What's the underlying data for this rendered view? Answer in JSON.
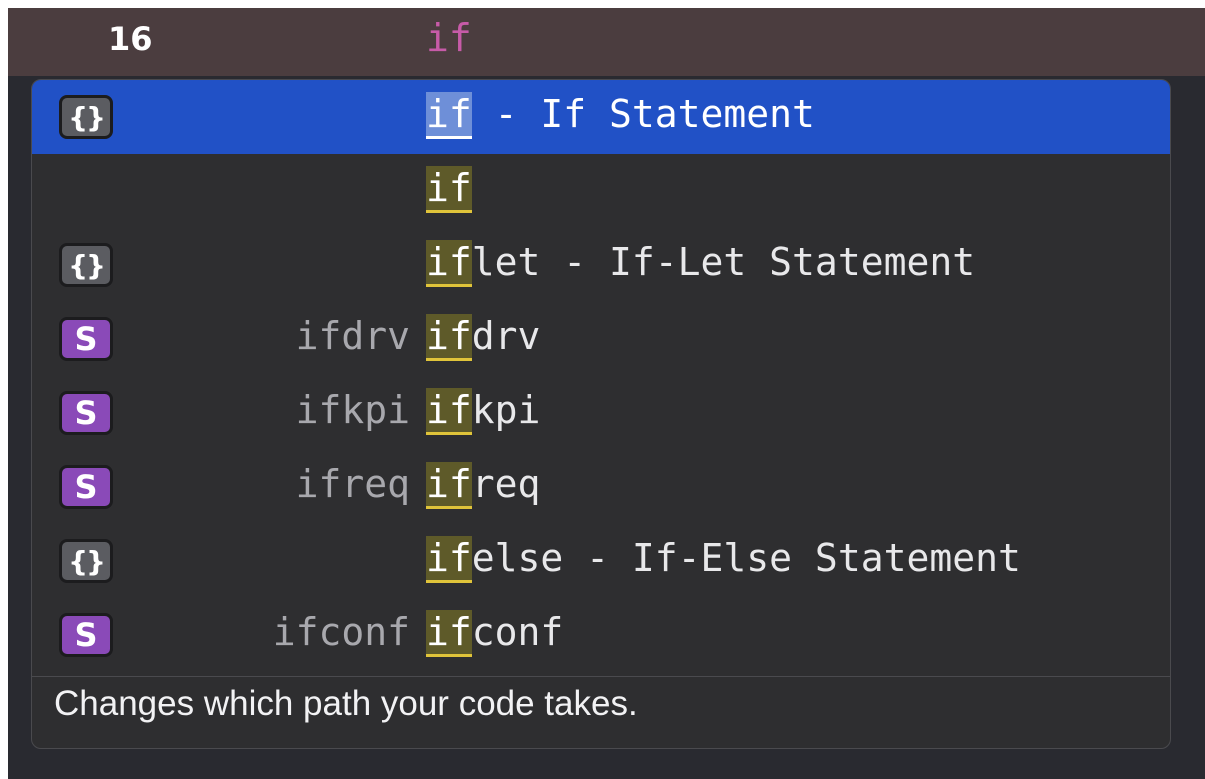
{
  "editor": {
    "line_number": "16",
    "line_code": "if",
    "colors": {
      "background": "#292a30",
      "current_line": "#4b3d3f",
      "keyword": "#c75ba8"
    }
  },
  "completion_popup": {
    "items": [
      {
        "icon": "snippet-braces-icon",
        "badge": "{}",
        "type_hint": "",
        "match": "if",
        "rest": " - If Statement",
        "selected": true
      },
      {
        "icon": "",
        "badge": "",
        "type_hint": "",
        "match": "if",
        "rest": "",
        "selected": false
      },
      {
        "icon": "snippet-braces-icon",
        "badge": "{}",
        "type_hint": "",
        "match": "if",
        "rest": "let - If-Let Statement",
        "selected": false
      },
      {
        "icon": "struct-s-icon",
        "badge": "S",
        "type_hint": "ifdrv",
        "match": "if",
        "rest": "drv",
        "selected": false
      },
      {
        "icon": "struct-s-icon",
        "badge": "S",
        "type_hint": "ifkpi",
        "match": "if",
        "rest": "kpi",
        "selected": false
      },
      {
        "icon": "struct-s-icon",
        "badge": "S",
        "type_hint": "ifreq",
        "match": "if",
        "rest": "req",
        "selected": false
      },
      {
        "icon": "snippet-braces-icon",
        "badge": "{}",
        "type_hint": "",
        "match": "if",
        "rest": "else - If-Else Statement",
        "selected": false
      },
      {
        "icon": "struct-s-icon",
        "badge": "S",
        "type_hint": "ifconf",
        "match": "if",
        "rest": "conf",
        "selected": false
      }
    ],
    "description": "Changes which path your code takes.",
    "colors": {
      "popup_bg": "#2e2e30",
      "selected_bg": "#2151c6",
      "snippet_badge": "#5b5c61",
      "struct_badge": "#8a4ab8",
      "match_underline": "#e0c43a"
    }
  }
}
